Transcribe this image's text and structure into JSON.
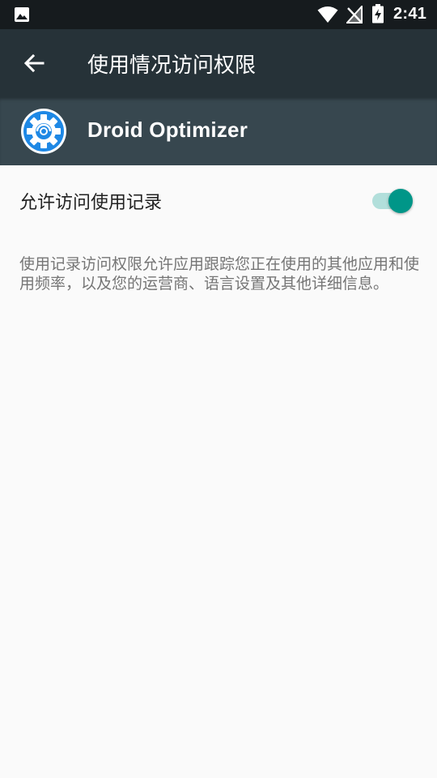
{
  "status_bar": {
    "time": "2:41",
    "left_icon": "image-notification-icon",
    "icons": [
      "wifi-icon",
      "no-signal-icon",
      "battery-charging-icon"
    ]
  },
  "app_bar": {
    "title": "使用情况访问权限",
    "back_icon": "arrow-back-icon"
  },
  "app_header": {
    "name": "Droid Optimizer",
    "logo_icon": "gear-logo-icon"
  },
  "setting": {
    "label": "允许访问使用记录",
    "toggle_on": true
  },
  "description": "使用记录访问权限允许应用跟踪您正在使用的其他应用和使用频率，以及您的运营商、语言设置及其他详细信息。",
  "colors": {
    "status_bar": "#161b1e",
    "app_bar": "#263238",
    "app_header": "#37474f",
    "background": "#fafafa",
    "accent": "#009688",
    "accent_track": "#b2dfdb",
    "logo_blue": "#1e88e5"
  }
}
